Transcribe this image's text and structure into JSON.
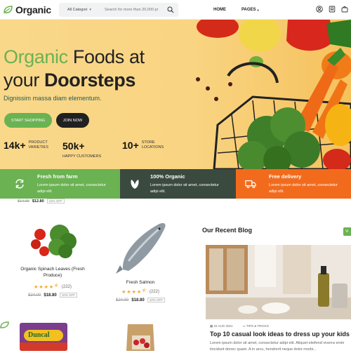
{
  "header": {
    "logo_text": "Organic",
    "search": {
      "category": "All Categori",
      "placeholder": "Search for more than 20,000 pr"
    },
    "nav": [
      {
        "label": "HOME"
      },
      {
        "label": "PAGES"
      }
    ],
    "icons": [
      "user-icon",
      "bookmark-icon",
      "bag-icon"
    ]
  },
  "hero": {
    "title_green": "Organic",
    "title_rest": "Foods at",
    "title_line2_plain": "your",
    "title_line2_bold": "Doorsteps",
    "subtitle": "Dignissim massa diam elementum.",
    "btn_shop": "START SHOPPING",
    "btn_join": "JOIN NOW",
    "stats": [
      {
        "num": "14k+",
        "label1": "PRODUCT",
        "label2": "VARIETIES"
      },
      {
        "num": "50k+",
        "label1": "HAPPY CUSTOMERS",
        "label2": ""
      },
      {
        "num": "10+",
        "label1": "STORE",
        "label2": "LOCATIONS"
      }
    ]
  },
  "features": [
    {
      "title": "Fresh from farm",
      "text1": "Lorem ipsum dolor sit amet, consectetur",
      "text2": "adipi elit.",
      "color": "#6bb252",
      "icon": "refresh-icon"
    },
    {
      "title": "100% Organic",
      "text1": "Lorem ipsum dolor sit amet, consectetur",
      "text2": "adipi elit.",
      "color": "#3b4a3f",
      "icon": "leaf-icon"
    },
    {
      "title": "Free delivery",
      "text1": "Lorem ipsum dolor sit amet, consectetur",
      "text2": "adipi elit.",
      "color": "#f26b1d",
      "icon": "truck-icon"
    }
  ],
  "partial_price": {
    "old": "$14.00",
    "new": "$12.80",
    "off": "10% OFF"
  },
  "products": [
    {
      "name_line1": "Organic Spinach Leaves (Fresh",
      "name_line2": "Produce)",
      "rating_count": "(222)",
      "old": "$24.00",
      "new": "$18.80",
      "off": "10% OFF",
      "rating": 4.5
    },
    {
      "name_line1": "Fresh Salmon",
      "name_line2": "",
      "rating_count": "(222)",
      "old": "$24.00",
      "new": "$18.80",
      "off": "10% OFF",
      "rating": 4.5
    }
  ],
  "bottom_products": [
    {
      "label": "Duncal"
    }
  ],
  "blog": {
    "section_title": "Our Recent Blog",
    "view_all": "Vi",
    "date": "22 AUG 2021",
    "category": "TIPS & TRICKS",
    "post_title": "Top 10 casual look ideas to dress up your kids",
    "excerpt1": "Lorem ipsum dolor sit amet, consectetur adipi elit. Aliquet eleifend viverra enim",
    "excerpt2": "tincidunt donec quam. A in arcu, hendrerit neque dolor morbi..."
  },
  "colors": {
    "brand_green": "#6bb252",
    "dark": "#212121",
    "orange": "#f26b1d"
  }
}
